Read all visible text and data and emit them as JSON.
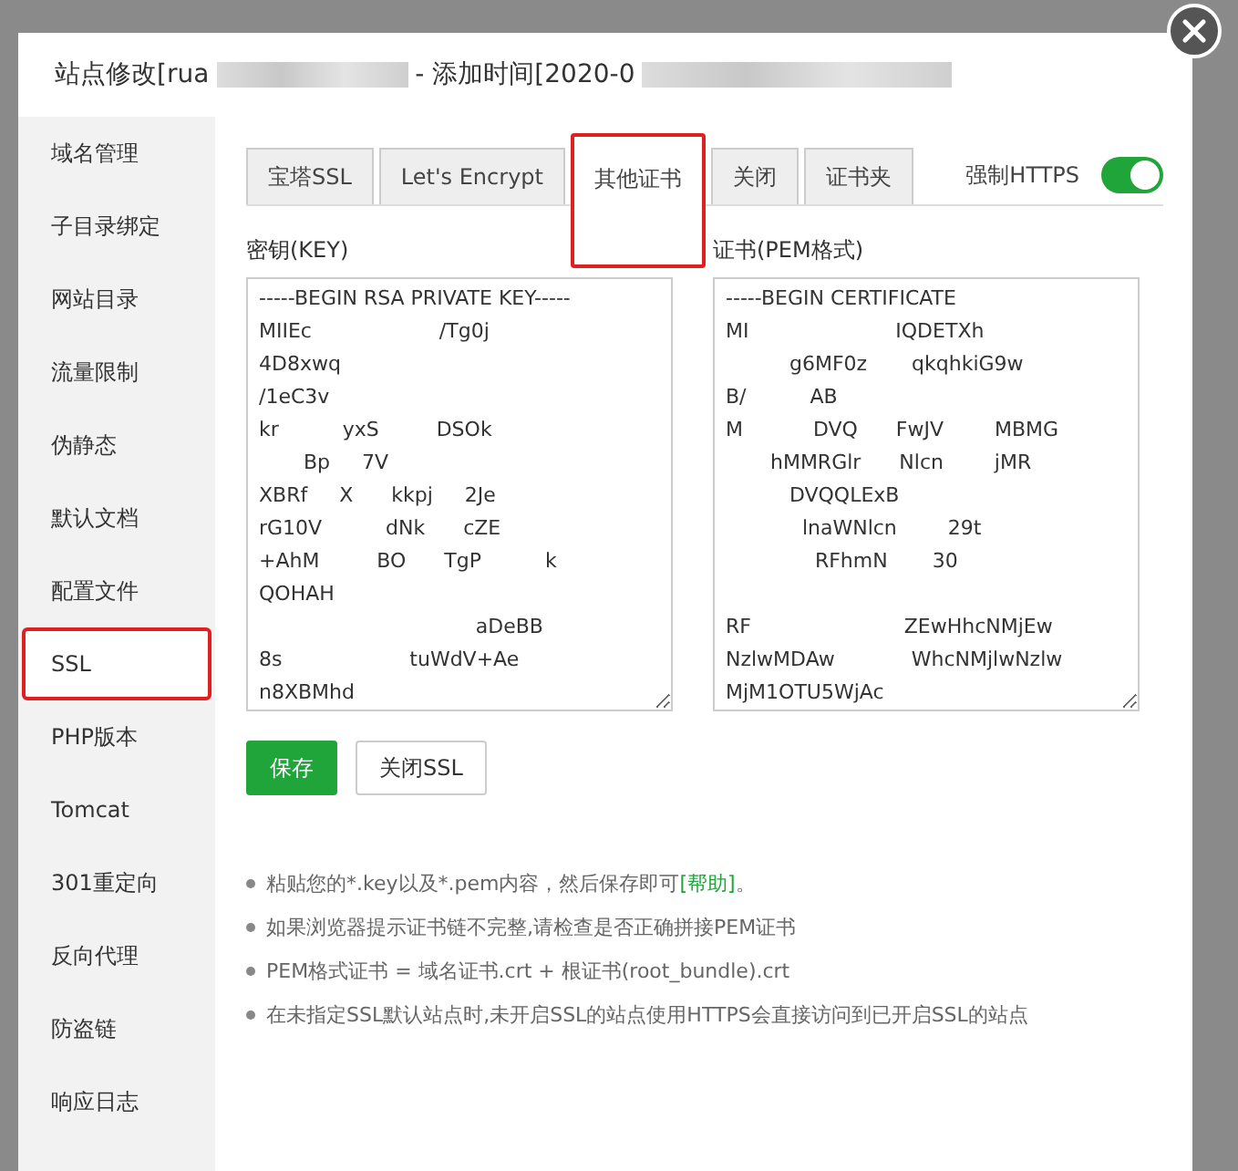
{
  "window": {
    "title_parts": [
      "站点修改[rua",
      "- 添加时间[2020-0"
    ]
  },
  "sidebar": {
    "items": [
      {
        "label": "域名管理",
        "selected": false
      },
      {
        "label": "子目录绑定",
        "selected": false
      },
      {
        "label": "网站目录",
        "selected": false
      },
      {
        "label": "流量限制",
        "selected": false
      },
      {
        "label": "伪静态",
        "selected": false
      },
      {
        "label": "默认文档",
        "selected": false
      },
      {
        "label": "配置文件",
        "selected": false
      },
      {
        "label": "SSL",
        "selected": true
      },
      {
        "label": "PHP版本",
        "selected": false
      },
      {
        "label": "Tomcat",
        "selected": false
      },
      {
        "label": "301重定向",
        "selected": false
      },
      {
        "label": "反向代理",
        "selected": false
      },
      {
        "label": "防盗链",
        "selected": false
      },
      {
        "label": "响应日志",
        "selected": false
      }
    ]
  },
  "tabs": [
    {
      "label": "宝塔SSL",
      "selected": false
    },
    {
      "label": "Let's Encrypt",
      "selected": false
    },
    {
      "label": "其他证书",
      "selected": true
    },
    {
      "label": "关闭",
      "selected": false
    },
    {
      "label": "证书夹",
      "selected": false
    }
  ],
  "force_https": {
    "label": "强制HTTPS",
    "on": true
  },
  "key_field": {
    "label": "密钥(KEY)",
    "value": "-----BEGIN RSA PRIVATE KEY-----\nMIIEc                    /Tg0j\n4D8xwq\n/1eC3v\nkr          yxS         DSOk\n       Bp     7V\nXBRf     X      kkpj     2Je\nrG10V          dNk      cZE\n+AhM         BO      TgP          k\nQOHAH\n                                  aDeBB\n8s                    tuWdV+Ae\nn8XBMhd"
  },
  "cert_field": {
    "label": "证书(PEM格式)",
    "value": "-----BEGIN CERTIFICATE\nMI                       IQDETXh\n          g6MF0z       qkqhkiG9w\nB/          AB\nM           DVQ      FwJV        MBMG\n       hMMRGlr      Nlcn        jMR\n          DVQQLExB\n            lnaWNlcn        29t\n              RFhmN       30\n\nRF                        ZEwHhcNMjEw\nNzlwMDAw            WhcNMjlwNzlw\nMjM1OTU5WjAc"
  },
  "buttons": [
    {
      "label": "保存",
      "kind": "primary"
    },
    {
      "label": "关闭SSL",
      "kind": "default"
    }
  ],
  "notes": [
    {
      "text": "粘贴您的*.key以及*.pem内容，然后保存即可",
      "link": "[帮助]",
      "tail": "。"
    },
    {
      "text": "如果浏览器提示证书链不完整,请检查是否正确拼接PEM证书"
    },
    {
      "text": "PEM格式证书 = 域名证书.crt + 根证书(root_bundle).crt"
    },
    {
      "text": "在未指定SSL默认站点时,未开启SSL的站点使用HTTPS会直接访问到已开启SSL的站点"
    }
  ]
}
